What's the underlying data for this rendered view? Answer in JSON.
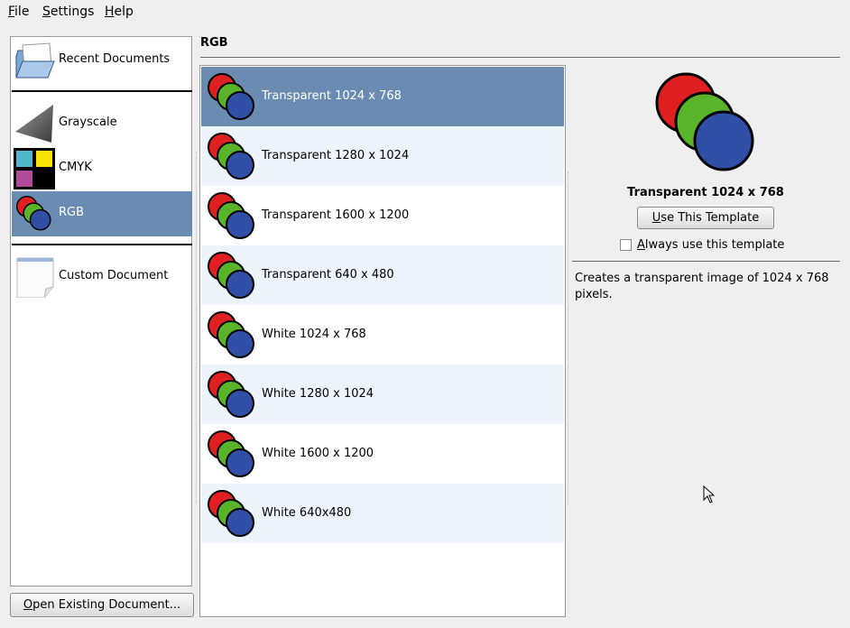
{
  "menubar": {
    "items": [
      {
        "ul": "F",
        "rest": "ile"
      },
      {
        "ul": "S",
        "rest": "ettings"
      },
      {
        "ul": "H",
        "rest": "elp"
      }
    ]
  },
  "categories": {
    "recent": "Recent Documents",
    "grayscale": "Grayscale",
    "cmyk": "CMYK",
    "rgb": "RGB",
    "custom": "Custom Document"
  },
  "open_button": {
    "ul": "O",
    "rest": "pen Existing Document..."
  },
  "section_title": "RGB",
  "templates": [
    "Transparent 1024 x 768",
    "Transparent 1280 x 1024",
    "Transparent 1600 x 1200",
    "Transparent 640 x 480",
    "White 1024 x 768",
    "White 1280 x 1024",
    "White 1600 x 1200",
    "White 640x480"
  ],
  "preview": {
    "name": "Transparent 1024 x 768",
    "use_button": {
      "ul": "U",
      "rest": "se This Template"
    },
    "always": {
      "ul": "A",
      "rest": "lways use this template"
    },
    "description": "Creates a transparent image of 1024 x 768 pixels."
  },
  "colors": {
    "selection": "#6a8cb2",
    "row_alt": "#eef4fb",
    "circle_red": "#e02020",
    "circle_green": "#5ab42a",
    "circle_blue": "#3050a8"
  }
}
